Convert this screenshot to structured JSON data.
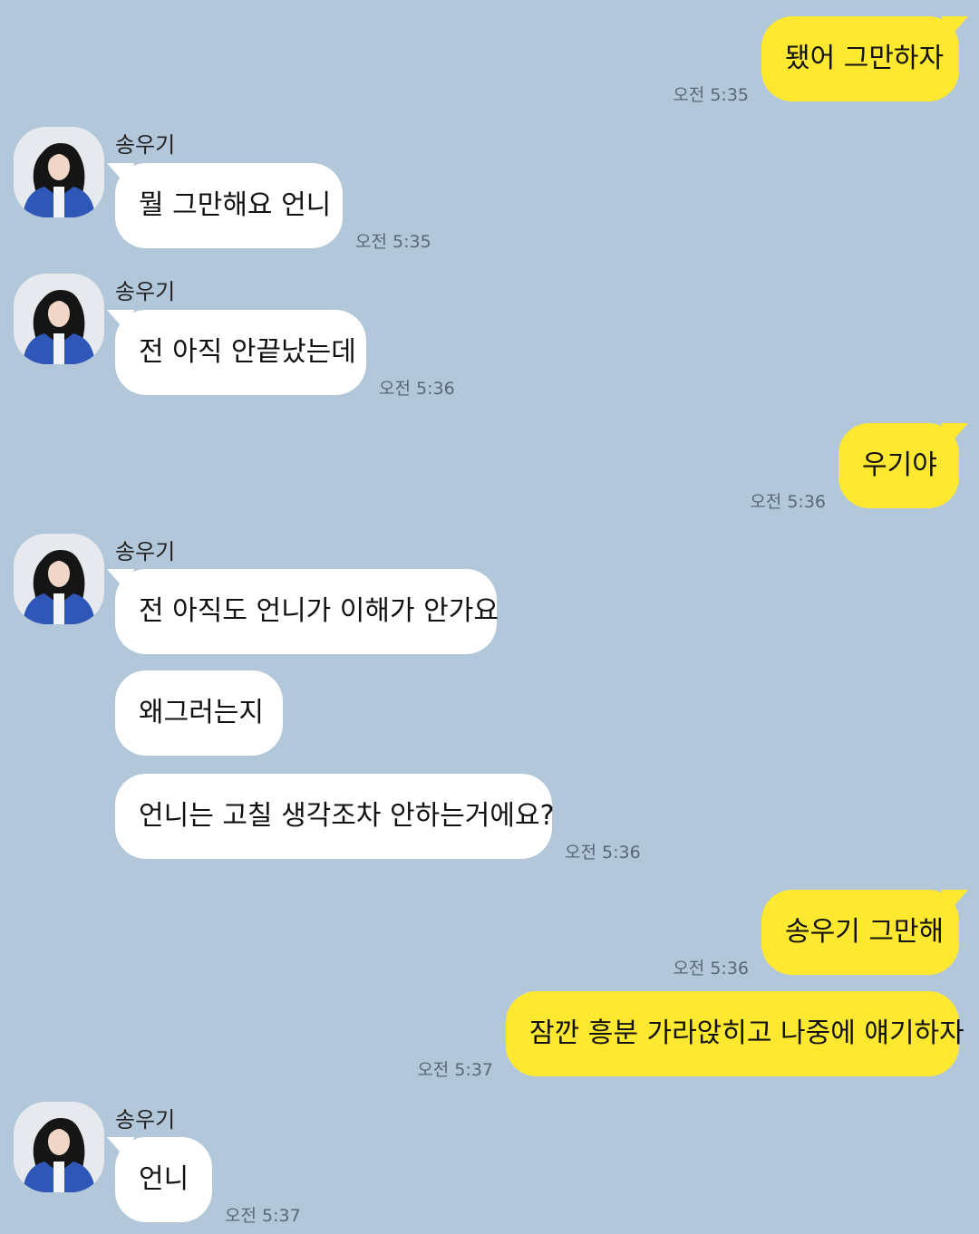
{
  "contact": {
    "name": "송우기"
  },
  "messages": [
    {
      "side": "me",
      "text": "됐어 그만하자",
      "time": "오전 5:35"
    },
    {
      "side": "you",
      "text": "뭘 그만해요 언니",
      "time": "오전 5:35"
    },
    {
      "side": "you",
      "text": "전 아직 안끝났는데",
      "time": "오전 5:36"
    },
    {
      "side": "me",
      "text": "우기야",
      "time": "오전 5:36"
    },
    {
      "side": "you",
      "text": "전 아직도 언니가 이해가 안가요",
      "time": ""
    },
    {
      "side": "you",
      "text": "왜그러는지",
      "time": ""
    },
    {
      "side": "you",
      "text": "언니는 고칠 생각조차 안하는거에요?",
      "time": "오전 5:36"
    },
    {
      "side": "me",
      "text": "송우기 그만해",
      "time": "오전 5:36"
    },
    {
      "side": "me",
      "text": "잠깐 흥분 가라앉히고 나중에 얘기하자",
      "time": "오전 5:37"
    },
    {
      "side": "you",
      "text": "언니",
      "time": "오전 5:37"
    }
  ],
  "colors": {
    "background": "#b2c7da",
    "my_bubble": "#fee830",
    "their_bubble": "#ffffff",
    "accent_blue": "#2f57b8"
  },
  "icons": {
    "avatar": "profile-photo-avatar"
  }
}
